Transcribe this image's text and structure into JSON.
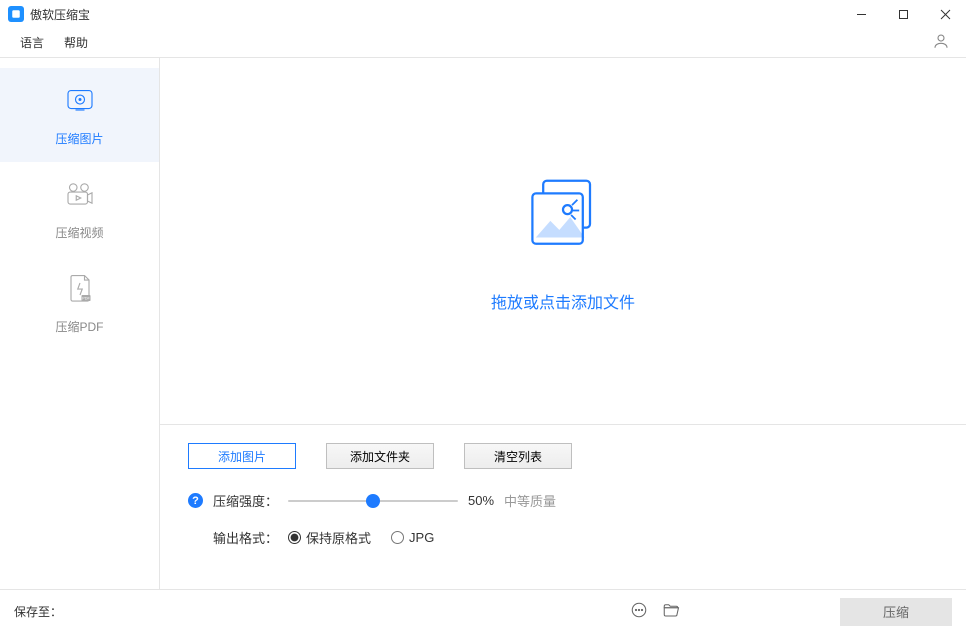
{
  "app": {
    "title": "傲软压缩宝"
  },
  "menu": {
    "language": "语言",
    "help": "帮助"
  },
  "sidebar": {
    "items": [
      {
        "label": "压缩图片"
      },
      {
        "label": "压缩视频"
      },
      {
        "label": "压缩PDF"
      }
    ]
  },
  "dropzone": {
    "hint": "拖放或点击添加文件"
  },
  "buttons": {
    "add_image": "添加图片",
    "add_folder": "添加文件夹",
    "clear_list": "清空列表"
  },
  "compress": {
    "strength_label": "压缩强度：",
    "percent": "50%",
    "quality": "中等质量"
  },
  "output": {
    "label": "输出格式：",
    "opt_keep": "保持原格式",
    "opt_jpg": "JPG"
  },
  "footer": {
    "save_to": "保存至：",
    "compress": "压缩"
  }
}
